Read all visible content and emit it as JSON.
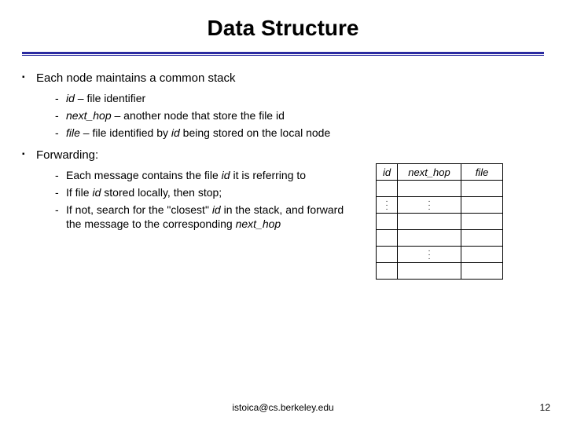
{
  "title": "Data Structure",
  "bullets": {
    "b1": "Each node maintains a common stack",
    "b1s1_a": "id",
    "b1s1_b": " – file identifier",
    "b1s2_a": "next_hop",
    "b1s2_b": " – another node that store the file id",
    "b1s3_a": "file",
    "b1s3_b": " – file identified by ",
    "b1s3_c": "id",
    "b1s3_d": " being stored on the local node",
    "b2": "Forwarding:",
    "b2s1_a": "Each message contains the file ",
    "b2s1_b": "id",
    "b2s1_c": " it is referring to",
    "b2s2_a": "If file ",
    "b2s2_b": "id",
    "b2s2_c": " stored locally, then stop;",
    "b2s3_a": "If not, search for the \"closest\" ",
    "b2s3_b": "id",
    "b2s3_c": " in the stack, and forward the message to the corresponding ",
    "b2s3_d": "next_hop"
  },
  "table": {
    "h1": "id",
    "h2": "next_hop",
    "h3": "file"
  },
  "footer": {
    "email": "istoica@cs.berkeley.edu",
    "page": "12"
  }
}
